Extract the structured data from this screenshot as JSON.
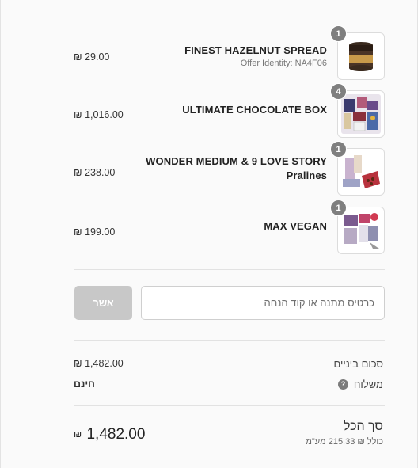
{
  "items": [
    {
      "name": "FINEST HAZELNUT SPREAD",
      "name2": "",
      "subtitle": "Offer Identity: NA4F06",
      "quantity": "1",
      "price": "₪ 29.00",
      "image_icon": "hazelnut-jar-icon"
    },
    {
      "name": "ULTIMATE CHOCOLATE BOX",
      "name2": "",
      "subtitle": "",
      "quantity": "4",
      "price": "₪ 1,016.00",
      "image_icon": "chocolate-box-icon"
    },
    {
      "name": "WONDER MEDIUM & 9 LOVE STORY",
      "name2": "Pralines",
      "subtitle": "",
      "quantity": "1",
      "price": "₪ 238.00",
      "image_icon": "pralines-gift-icon"
    },
    {
      "name": "MAX VEGAN",
      "name2": "",
      "subtitle": "",
      "quantity": "1",
      "price": "₪ 199.00",
      "image_icon": "vegan-gift-icon"
    }
  ],
  "discount": {
    "placeholder": "כרטיס מתנה או קוד הנחה",
    "value": "",
    "apply_label": "אשר"
  },
  "summary": {
    "subtotal_label": "סכום ביניים",
    "subtotal_value": "₪ 1,482.00",
    "shipping_label": "משלוח",
    "shipping_value": "חינם",
    "help_glyph": "?",
    "total_label": "סך הכל",
    "total_currency": "₪",
    "total_value": "1,482.00",
    "tax_note": "כולל ₪ 215.33 מע\"מ"
  },
  "colors": {
    "qty_badge": "#7f7f7f",
    "apply_disabled": "#c8c8c8",
    "background": "#fafafa"
  }
}
